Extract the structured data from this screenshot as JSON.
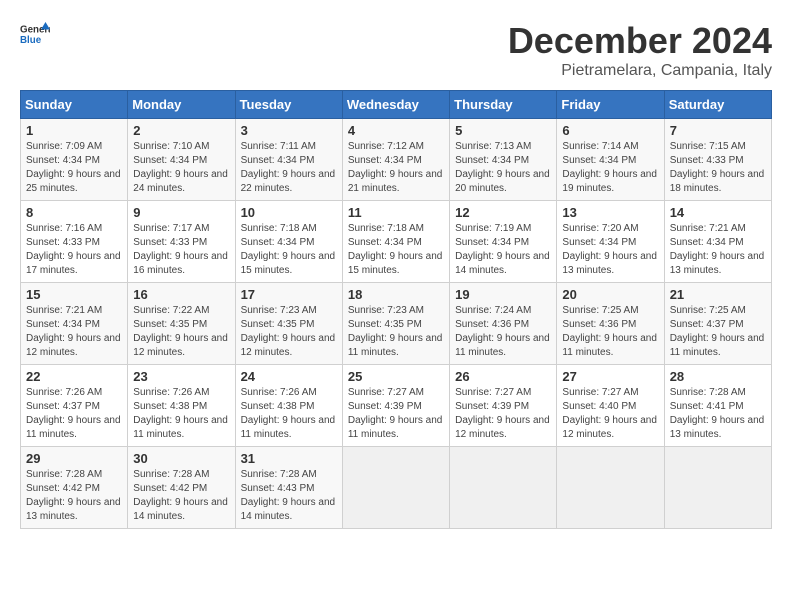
{
  "logo": {
    "general": "General",
    "blue": "Blue"
  },
  "header": {
    "month": "December 2024",
    "location": "Pietramelara, Campania, Italy"
  },
  "weekdays": [
    "Sunday",
    "Monday",
    "Tuesday",
    "Wednesday",
    "Thursday",
    "Friday",
    "Saturday"
  ],
  "weeks": [
    [
      {
        "day": "1",
        "sunrise": "7:09 AM",
        "sunset": "4:34 PM",
        "daylight": "9 hours and 25 minutes."
      },
      {
        "day": "2",
        "sunrise": "7:10 AM",
        "sunset": "4:34 PM",
        "daylight": "9 hours and 24 minutes."
      },
      {
        "day": "3",
        "sunrise": "7:11 AM",
        "sunset": "4:34 PM",
        "daylight": "9 hours and 22 minutes."
      },
      {
        "day": "4",
        "sunrise": "7:12 AM",
        "sunset": "4:34 PM",
        "daylight": "9 hours and 21 minutes."
      },
      {
        "day": "5",
        "sunrise": "7:13 AM",
        "sunset": "4:34 PM",
        "daylight": "9 hours and 20 minutes."
      },
      {
        "day": "6",
        "sunrise": "7:14 AM",
        "sunset": "4:34 PM",
        "daylight": "9 hours and 19 minutes."
      },
      {
        "day": "7",
        "sunrise": "7:15 AM",
        "sunset": "4:33 PM",
        "daylight": "9 hours and 18 minutes."
      }
    ],
    [
      {
        "day": "8",
        "sunrise": "7:16 AM",
        "sunset": "4:33 PM",
        "daylight": "9 hours and 17 minutes."
      },
      {
        "day": "9",
        "sunrise": "7:17 AM",
        "sunset": "4:33 PM",
        "daylight": "9 hours and 16 minutes."
      },
      {
        "day": "10",
        "sunrise": "7:18 AM",
        "sunset": "4:34 PM",
        "daylight": "9 hours and 15 minutes."
      },
      {
        "day": "11",
        "sunrise": "7:18 AM",
        "sunset": "4:34 PM",
        "daylight": "9 hours and 15 minutes."
      },
      {
        "day": "12",
        "sunrise": "7:19 AM",
        "sunset": "4:34 PM",
        "daylight": "9 hours and 14 minutes."
      },
      {
        "day": "13",
        "sunrise": "7:20 AM",
        "sunset": "4:34 PM",
        "daylight": "9 hours and 13 minutes."
      },
      {
        "day": "14",
        "sunrise": "7:21 AM",
        "sunset": "4:34 PM",
        "daylight": "9 hours and 13 minutes."
      }
    ],
    [
      {
        "day": "15",
        "sunrise": "7:21 AM",
        "sunset": "4:34 PM",
        "daylight": "9 hours and 12 minutes."
      },
      {
        "day": "16",
        "sunrise": "7:22 AM",
        "sunset": "4:35 PM",
        "daylight": "9 hours and 12 minutes."
      },
      {
        "day": "17",
        "sunrise": "7:23 AM",
        "sunset": "4:35 PM",
        "daylight": "9 hours and 12 minutes."
      },
      {
        "day": "18",
        "sunrise": "7:23 AM",
        "sunset": "4:35 PM",
        "daylight": "9 hours and 11 minutes."
      },
      {
        "day": "19",
        "sunrise": "7:24 AM",
        "sunset": "4:36 PM",
        "daylight": "9 hours and 11 minutes."
      },
      {
        "day": "20",
        "sunrise": "7:25 AM",
        "sunset": "4:36 PM",
        "daylight": "9 hours and 11 minutes."
      },
      {
        "day": "21",
        "sunrise": "7:25 AM",
        "sunset": "4:37 PM",
        "daylight": "9 hours and 11 minutes."
      }
    ],
    [
      {
        "day": "22",
        "sunrise": "7:26 AM",
        "sunset": "4:37 PM",
        "daylight": "9 hours and 11 minutes."
      },
      {
        "day": "23",
        "sunrise": "7:26 AM",
        "sunset": "4:38 PM",
        "daylight": "9 hours and 11 minutes."
      },
      {
        "day": "24",
        "sunrise": "7:26 AM",
        "sunset": "4:38 PM",
        "daylight": "9 hours and 11 minutes."
      },
      {
        "day": "25",
        "sunrise": "7:27 AM",
        "sunset": "4:39 PM",
        "daylight": "9 hours and 11 minutes."
      },
      {
        "day": "26",
        "sunrise": "7:27 AM",
        "sunset": "4:39 PM",
        "daylight": "9 hours and 12 minutes."
      },
      {
        "day": "27",
        "sunrise": "7:27 AM",
        "sunset": "4:40 PM",
        "daylight": "9 hours and 12 minutes."
      },
      {
        "day": "28",
        "sunrise": "7:28 AM",
        "sunset": "4:41 PM",
        "daylight": "9 hours and 13 minutes."
      }
    ],
    [
      {
        "day": "29",
        "sunrise": "7:28 AM",
        "sunset": "4:42 PM",
        "daylight": "9 hours and 13 minutes."
      },
      {
        "day": "30",
        "sunrise": "7:28 AM",
        "sunset": "4:42 PM",
        "daylight": "9 hours and 14 minutes."
      },
      {
        "day": "31",
        "sunrise": "7:28 AM",
        "sunset": "4:43 PM",
        "daylight": "9 hours and 14 minutes."
      },
      null,
      null,
      null,
      null
    ]
  ],
  "labels": {
    "sunrise": "Sunrise:",
    "sunset": "Sunset:",
    "daylight": "Daylight:"
  }
}
